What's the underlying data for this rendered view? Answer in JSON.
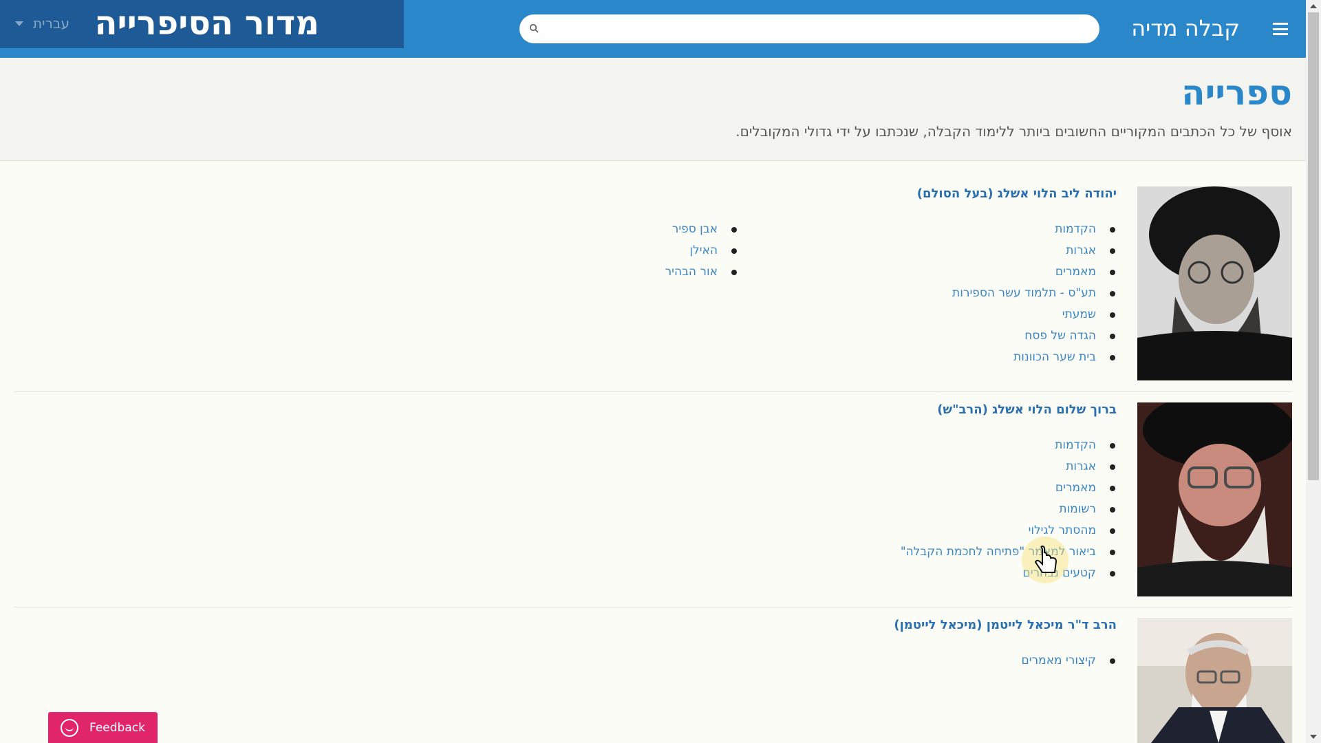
{
  "header": {
    "section_title": "מדור הסיפרייה",
    "language": "עברית",
    "search_placeholder": "",
    "brand": "קבלה מדיה"
  },
  "page": {
    "title": "ספרייה",
    "description": "אוסף של כל הכתבים המקוריים החשובים ביותר ללימוד הקבלה, שנכתבו על ידי גדולי המקובלים."
  },
  "authors": [
    {
      "name": "יהודה ליב הלוי אשלג (בעל הסולם)",
      "books_right": [
        "הקדמות",
        "אגרות",
        "מאמרים",
        "תע\"ס - תלמוד עשר הספירות",
        "שמעתי",
        "הגדה של פסח",
        "בית שער הכוונות"
      ],
      "books_left": [
        "אבן ספיר",
        "האילן",
        "אור הבהיר"
      ]
    },
    {
      "name": "ברוך שלום הלוי אשלג (הרב\"ש)",
      "books_right": [
        "הקדמות",
        "אגרות",
        "מאמרים",
        "רשומות",
        "מהסתר לגילוי",
        "ביאור למאמר \"פתיחה לחכמת הקבלה\"",
        "קטעים נבחרים"
      ]
    },
    {
      "name": "הרב ד\"ר מיכאל לייטמן (מיכאל לייטמן)",
      "books_right": [
        "קיצורי מאמרים"
      ]
    }
  ],
  "feedback": {
    "label": "Feedback"
  },
  "colors": {
    "header_blue": "#2a87c9",
    "section_navy": "#1e5a96",
    "link_blue": "#3a86c4",
    "feedback_pink": "#e0256b"
  }
}
